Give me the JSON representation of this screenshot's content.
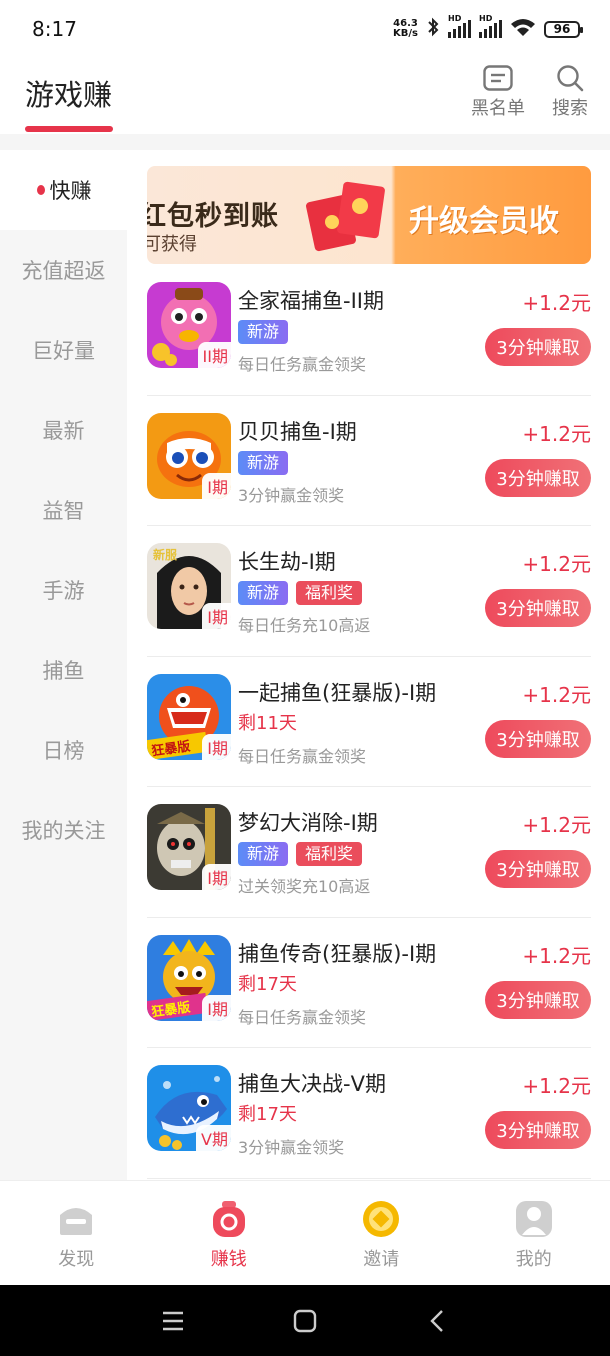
{
  "status_bar": {
    "time": "8:17",
    "net_speed": "46.3",
    "net_unit": "KB/s",
    "signal_hd": "HD",
    "battery": "96"
  },
  "header": {
    "title": "游戏赚",
    "blacklist_label": "黑名单",
    "search_label": "搜索"
  },
  "sidebar": {
    "items": [
      {
        "label": "快赚",
        "active": true
      },
      {
        "label": "充值超返"
      },
      {
        "label": "巨好量"
      },
      {
        "label": "最新"
      },
      {
        "label": "益智"
      },
      {
        "label": "手游"
      },
      {
        "label": "捕鱼"
      },
      {
        "label": "日榜"
      },
      {
        "label": "我的关注"
      }
    ]
  },
  "banner": {
    "left_text": "红包秒到账",
    "left_sub": "可获得",
    "right_text": "升级会员收"
  },
  "games": [
    {
      "name": "全家福捕鱼-II期",
      "period": "II期",
      "tag1": "新游",
      "tag2": "",
      "desc": "每日任务赢金领奖",
      "reward": "+1.2元",
      "button": "3分钟赚取"
    },
    {
      "name": "贝贝捕鱼-I期",
      "period": "I期",
      "tag1": "新游",
      "tag2": "",
      "desc": "3分钟赢金领奖",
      "reward": "+1.2元",
      "button": "3分钟赚取"
    },
    {
      "name": "长生劫-I期",
      "period": "I期",
      "tag1": "新游",
      "tag2": "福利奖",
      "desc": "每日任务充10高返",
      "reward": "+1.2元",
      "button": "3分钟赚取"
    },
    {
      "name": "一起捕鱼(狂暴版)-I期",
      "period": "I期",
      "remain": "剩11天",
      "desc": "每日任务赢金领奖",
      "reward": "+1.2元",
      "button": "3分钟赚取"
    },
    {
      "name": "梦幻大消除-I期",
      "period": "I期",
      "tag1": "新游",
      "tag2": "福利奖",
      "desc": "过关领奖充10高返",
      "reward": "+1.2元",
      "button": "3分钟赚取"
    },
    {
      "name": "捕鱼传奇(狂暴版)-I期",
      "period": "I期",
      "remain": "剩17天",
      "desc": "每日任务赢金领奖",
      "reward": "+1.2元",
      "button": "3分钟赚取"
    },
    {
      "name": "捕鱼大决战-V期",
      "period": "V期",
      "remain": "剩17天",
      "desc": "3分钟赢金领奖",
      "reward": "+1.2元",
      "button": "3分钟赚取"
    }
  ],
  "icon_labels": {
    "yiqi": "狂暴版",
    "chuanqi": "狂暴版",
    "changsheng": "新服"
  },
  "bottom_nav": [
    {
      "label": "发现",
      "icon": "discover-icon"
    },
    {
      "label": "赚钱",
      "icon": "money-bag-icon",
      "active": true
    },
    {
      "label": "邀请",
      "icon": "coin-icon"
    },
    {
      "label": "我的",
      "icon": "profile-icon"
    }
  ],
  "colors": {
    "accent": "#e6344a",
    "tag_new": "#6e7cf4",
    "tag_welfare": "#ea4d5c",
    "invite_gold": "#f5b800"
  }
}
